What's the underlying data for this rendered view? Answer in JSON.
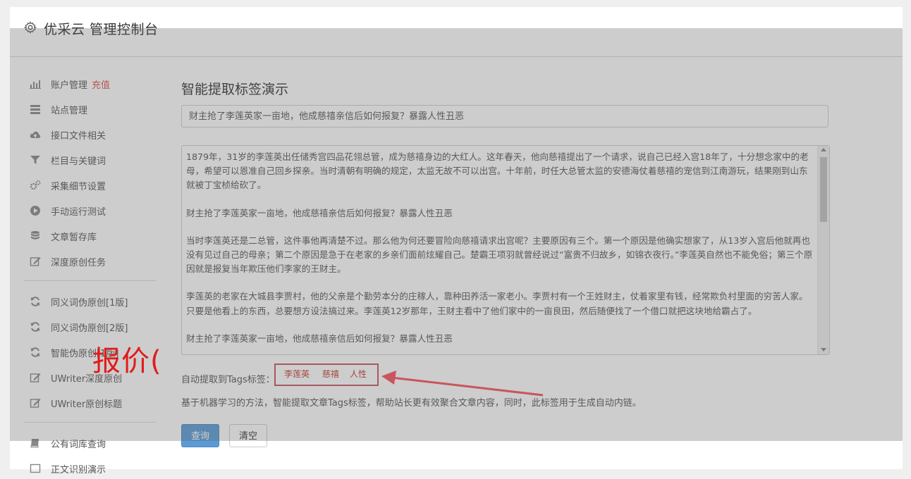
{
  "app": {
    "title": "优采云 管理控制台"
  },
  "sidebar": {
    "group1": [
      {
        "label": "账户管理",
        "extra": "充值",
        "icon": "bar-chart-icon"
      },
      {
        "label": "站点管理",
        "icon": "list-icon"
      },
      {
        "label": "接口文件相关",
        "icon": "cloud-upload-icon"
      },
      {
        "label": "栏目与关键词",
        "icon": "filter-icon"
      },
      {
        "label": "采集细节设置",
        "icon": "gears-icon"
      },
      {
        "label": "手动运行测试",
        "icon": "play-circle-icon"
      },
      {
        "label": "文章暂存库",
        "icon": "database-icon"
      },
      {
        "label": "深度原创任务",
        "icon": "edit-icon"
      }
    ],
    "group2": [
      {
        "label": "同义词伪原创[1版]",
        "icon": "refresh-icon"
      },
      {
        "label": "同义词伪原创[2版]",
        "icon": "refresh-icon"
      },
      {
        "label": "智能伪原创[1版]",
        "icon": "refresh-icon"
      },
      {
        "label": "UWriter深度原创",
        "icon": "edit-icon"
      },
      {
        "label": "UWriter原创标题",
        "icon": "edit-icon"
      }
    ],
    "group3": [
      {
        "label": "公有词库查询",
        "icon": "book-icon"
      },
      {
        "label": "正文识别演示",
        "icon": "square-icon"
      }
    ]
  },
  "main": {
    "page_title": "智能提取标签演示",
    "title_input_value": "财主抢了李莲英家一亩地，他成慈禧亲信后如何报复？暴露人性丑恶",
    "content_paragraphs": [
      "1879年，31岁的李莲英出任储秀宫四品花翎总管，成为慈禧身边的大红人。这年春天，他向慈禧提出了一个请求，说自己已经入宫18年了，十分想念家中的老母，希望可以恩准自己回乡探亲。当时清朝有明确的规定，太监无故不可以出宫。十年前，时任大总管太监的安德海仗着慈禧的宠信到江南游玩，结果刚到山东就被丁宝桢给砍了。",
      "财主抢了李莲英家一亩地，他成慈禧亲信后如何报复？暴露人性丑恶",
      "当时李莲英还是二总管，这件事他再清楚不过。那么他为何还要冒险向慈禧请求出宫呢？主要原因有三个。第一个原因是他确实想家了，从13岁入宫后他就再也没有见过自己的母亲；第二个原因是急于在老家的乡亲们面前炫耀自己。楚霸王项羽就曾经说过“富贵不归故乡，如锦衣夜行。”李莲英自然也不能免俗；第三个原因就是报复当年欺压他们李家的王财主。",
      "李莲英的老家在大城县李贾村，他的父亲是个勤劳本分的庄稼人，靠种田养活一家老小。李贾村有一个王姓财主，仗着家里有钱，经常欺负村里面的穷苦人家。只要是他看上的东西，总要想方设法搞过来。李莲英12岁那年，王财主看中了他们家中的一亩良田，然后随便找了一个借口就把这块地给霸占了。",
      "财主抢了李莲英家一亩地，他成慈禧亲信后如何报复？暴露人性丑恶"
    ],
    "tags_label": "自动提取到Tags标签：",
    "tags": [
      "李莲英",
      "慈禧",
      "人性"
    ],
    "description": "基于机器学习的方法，智能提取文章Tags标签，帮助站长更有效聚合文章内容，同时，此标签用于生成自动内链。",
    "query_button": "查询",
    "clear_button": "清空"
  },
  "annotation": {
    "text": "报价("
  },
  "colors": {
    "accent": "#5b9bd5",
    "recharge": "#d9534f",
    "annotation_red": "#e21b1b",
    "highlight_box": "#c9555d"
  }
}
